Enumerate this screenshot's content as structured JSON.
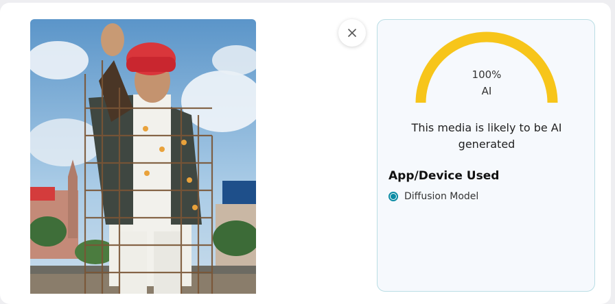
{
  "close_button": {
    "icon": "close-icon"
  },
  "photo": {
    "icon": "generated-photo"
  },
  "result": {
    "score_percent": 100,
    "score_text": "100%",
    "label": "AI",
    "gauge_color": "#f7c51a",
    "verdict": "This media is likely to be AI generated"
  },
  "app_device": {
    "title": "App/Device Used",
    "options": [
      {
        "label": "Diffusion Model",
        "selected": true
      }
    ]
  },
  "colors": {
    "accent": "#0b8ba4",
    "panel_border": "#b9dde4",
    "panel_bg": "#f6f9fd"
  }
}
